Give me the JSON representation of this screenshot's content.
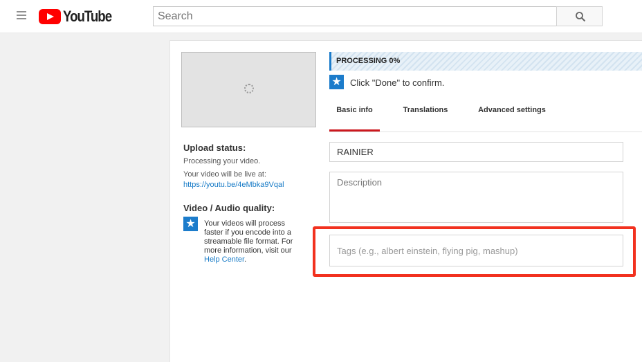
{
  "header": {
    "logo_text": "YouTube",
    "search_placeholder": "Search"
  },
  "icons": {
    "menu": "hamburger-menu-icon",
    "search": "magnifier-icon",
    "info": "star-icon",
    "spinner": "loading-spinner-icon"
  },
  "colors": {
    "brand": "#ff0000",
    "accent": "#1c7ccb",
    "tab_underline": "#cc181e",
    "highlight": "#f2311f"
  },
  "status": {
    "processing_label": "PROCESSING 0%",
    "processing_progress": 0,
    "confirm_message": "Click \"Done\" to confirm."
  },
  "tabs": [
    {
      "label": "Basic info",
      "active": true
    },
    {
      "label": "Translations",
      "active": false
    },
    {
      "label": "Advanced settings",
      "active": false
    }
  ],
  "form": {
    "title_value": "RAINIER",
    "description_placeholder": "Description",
    "tags_placeholder": "Tags (e.g., albert einstein, flying pig, mashup)"
  },
  "upload": {
    "status_heading": "Upload status:",
    "status_text": "Processing your video.",
    "live_text": "Your video will be live at:",
    "video_url": "https://youtu.be/4eMbka9Vqal"
  },
  "quality": {
    "heading": "Video / Audio quality:",
    "message": "Your videos will process faster if you encode into a streamable file format. For more information, visit our",
    "link_text": "Help Center",
    "suffix": "."
  }
}
